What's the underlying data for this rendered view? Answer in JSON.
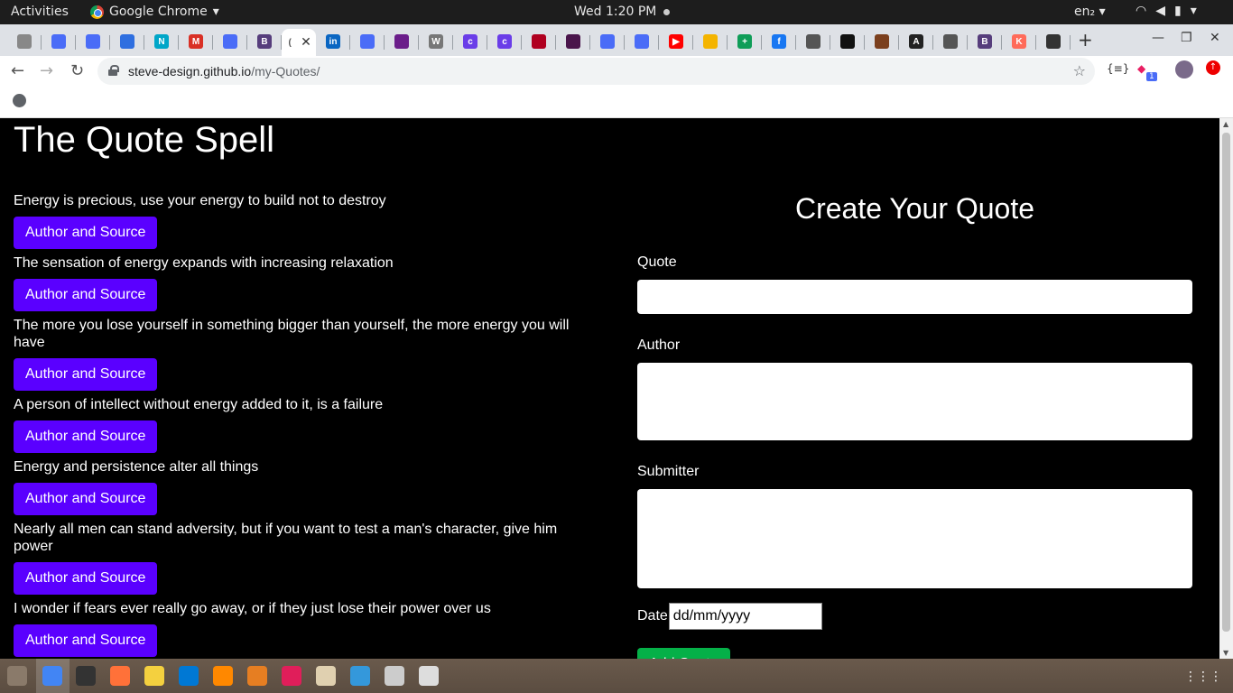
{
  "topbar": {
    "activities": "Activities",
    "app_name": "Google Chrome",
    "clock": "Wed  1:20 PM",
    "lang": "en₂"
  },
  "tabs": [
    {
      "icon": "cloud-icon",
      "color": "#888"
    },
    {
      "icon": "docs-icon",
      "color": "#4a6cf7"
    },
    {
      "icon": "docs-icon",
      "color": "#4a6cf7"
    },
    {
      "icon": "window-icon",
      "color": "#2f6fe0"
    },
    {
      "icon": "n-icon",
      "color": "#00a6c8"
    },
    {
      "icon": "gmail-icon",
      "color": "#d93025"
    },
    {
      "icon": "docs-icon",
      "color": "#4a6cf7"
    },
    {
      "icon": "bootstrap-icon",
      "color": "#563d7c"
    },
    {
      "icon": "active-tab-icon",
      "color": "#999"
    },
    {
      "icon": "linkedin-icon",
      "color": "#0a66c2"
    },
    {
      "icon": "instagram-icon",
      "color": "#4a6cf7"
    },
    {
      "icon": "colorlib-icon",
      "color": "#6b1d8a"
    },
    {
      "icon": "wordpress-icon",
      "color": "#777"
    },
    {
      "icon": "c-icon",
      "color": "#6a3de8"
    },
    {
      "icon": "c-icon",
      "color": "#6a3de8"
    },
    {
      "icon": "dots-icon",
      "color": "#b00020"
    },
    {
      "icon": "slack-icon",
      "color": "#4a154b"
    },
    {
      "icon": "docs-icon",
      "color": "#4a6cf7"
    },
    {
      "icon": "docs-icon",
      "color": "#4a6cf7"
    },
    {
      "icon": "youtube-icon",
      "color": "#ff0000"
    },
    {
      "icon": "slides-icon",
      "color": "#f4b400"
    },
    {
      "icon": "sheets-icon",
      "color": "#0f9d58"
    },
    {
      "icon": "facebook-icon",
      "color": "#1877f2"
    },
    {
      "icon": "audio-icon",
      "color": "#555"
    },
    {
      "icon": "github-icon",
      "color": "#111"
    },
    {
      "icon": "brown-icon",
      "color": "#7b3f1d"
    },
    {
      "icon": "angular-icon",
      "color": "#222"
    },
    {
      "icon": "layers-icon",
      "color": "#555"
    },
    {
      "icon": "bootstrap-icon",
      "color": "#563d7c"
    },
    {
      "icon": "k-icon",
      "color": "#ff6b5a"
    },
    {
      "icon": "flame-icon",
      "color": "#333"
    }
  ],
  "tab_letters": [
    "",
    "",
    "",
    "",
    "N",
    "M",
    "",
    "B",
    "",
    "in",
    "",
    "",
    "W",
    "c",
    "c",
    "",
    "",
    "",
    "",
    "▶",
    "",
    "+",
    "f",
    "",
    "",
    "",
    "A",
    "",
    "B",
    "K",
    ""
  ],
  "address": {
    "host": "steve-design.github.io",
    "path": "/my-Quotes/"
  },
  "extensions": {
    "badge": "1"
  },
  "page": {
    "title": "The Quote Spell",
    "button_label": "Author and Source",
    "quotes": [
      "Energy is precious, use your energy to build not to destroy",
      "The sensation of energy expands with increasing relaxation",
      "The more you lose yourself in something bigger than yourself, the more energy you will have",
      "A person of intellect without energy added to it, is a failure",
      "Energy and persistence alter all things",
      "Nearly all men can stand adversity, but if you want to test a man's character, give him power",
      "I wonder if fears ever really go away, or if they just lose their power over us"
    ],
    "form": {
      "heading": "Create Your Quote",
      "quote_label": "Quote",
      "author_label": "Author",
      "submitter_label": "Submitter",
      "date_label": "Date",
      "date_placeholder": "dd/mm/yyyy",
      "submit_label": "Add Quote"
    }
  },
  "colors": {
    "button_purple": "#5a00ff",
    "button_green": "#05b048",
    "page_bg": "#000000"
  }
}
